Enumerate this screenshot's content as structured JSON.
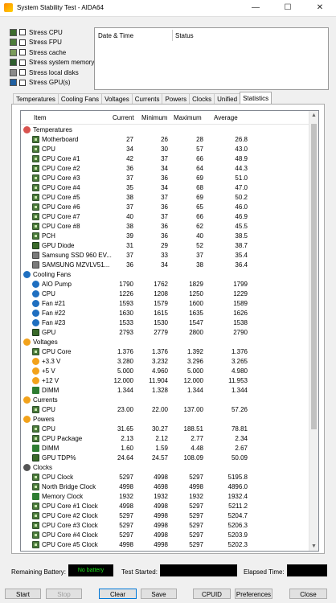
{
  "window": {
    "title": "System Stability Test - AIDA64",
    "minimize": "—",
    "maximize": "☐",
    "close": "✕"
  },
  "stress": [
    {
      "label": "Stress CPU",
      "checked": false
    },
    {
      "label": "Stress FPU",
      "checked": false
    },
    {
      "label": "Stress cache",
      "checked": false
    },
    {
      "label": "Stress system memory",
      "checked": false
    },
    {
      "label": "Stress local disks",
      "checked": false
    },
    {
      "label": "Stress GPU(s)",
      "checked": false
    }
  ],
  "log": {
    "col_date": "Date & Time",
    "col_status": "Status"
  },
  "tabs": [
    "Temperatures",
    "Cooling Fans",
    "Voltages",
    "Currents",
    "Powers",
    "Clocks",
    "Unified",
    "Statistics"
  ],
  "active_tab": "Statistics",
  "stats": {
    "headers": {
      "item": "Item",
      "current": "Current",
      "minimum": "Minimum",
      "maximum": "Maximum",
      "average": "Average"
    },
    "rows": [
      {
        "kind": "section",
        "icon": "temperature-icon",
        "label": "Temperatures"
      },
      {
        "kind": "item",
        "icon": "chip",
        "label": "Motherboard",
        "cur": "27",
        "min": "26",
        "max": "28",
        "avg": "26.8"
      },
      {
        "kind": "item",
        "icon": "chip",
        "label": "CPU",
        "cur": "34",
        "min": "30",
        "max": "57",
        "avg": "43.0"
      },
      {
        "kind": "item",
        "icon": "chip",
        "label": "CPU Core #1",
        "cur": "42",
        "min": "37",
        "max": "66",
        "avg": "48.9"
      },
      {
        "kind": "item",
        "icon": "chip",
        "label": "CPU Core #2",
        "cur": "36",
        "min": "34",
        "max": "64",
        "avg": "44.3"
      },
      {
        "kind": "item",
        "icon": "chip",
        "label": "CPU Core #3",
        "cur": "37",
        "min": "36",
        "max": "69",
        "avg": "51.0"
      },
      {
        "kind": "item",
        "icon": "chip",
        "label": "CPU Core #4",
        "cur": "35",
        "min": "34",
        "max": "68",
        "avg": "47.0"
      },
      {
        "kind": "item",
        "icon": "chip",
        "label": "CPU Core #5",
        "cur": "38",
        "min": "37",
        "max": "69",
        "avg": "50.2"
      },
      {
        "kind": "item",
        "icon": "chip",
        "label": "CPU Core #6",
        "cur": "37",
        "min": "36",
        "max": "65",
        "avg": "46.0"
      },
      {
        "kind": "item",
        "icon": "chip",
        "label": "CPU Core #7",
        "cur": "40",
        "min": "37",
        "max": "66",
        "avg": "46.9"
      },
      {
        "kind": "item",
        "icon": "chip",
        "label": "CPU Core #8",
        "cur": "38",
        "min": "36",
        "max": "62",
        "avg": "45.5"
      },
      {
        "kind": "item",
        "icon": "chip",
        "label": "PCH",
        "cur": "39",
        "min": "36",
        "max": "40",
        "avg": "38.5"
      },
      {
        "kind": "item",
        "icon": "gpu",
        "label": "GPU Diode",
        "cur": "31",
        "min": "29",
        "max": "52",
        "avg": "38.7"
      },
      {
        "kind": "item",
        "icon": "disk",
        "label": "Samsung SSD 960 EV...",
        "cur": "37",
        "min": "33",
        "max": "37",
        "avg": "35.4"
      },
      {
        "kind": "item",
        "icon": "disk",
        "label": "SAMSUNG MZVLV51...",
        "cur": "36",
        "min": "34",
        "max": "38",
        "avg": "36.4"
      },
      {
        "kind": "section",
        "icon": "fan-icon",
        "label": "Cooling Fans"
      },
      {
        "kind": "item",
        "icon": "fan",
        "label": "AIO Pump",
        "cur": "1790",
        "min": "1762",
        "max": "1829",
        "avg": "1799"
      },
      {
        "kind": "item",
        "icon": "fan",
        "label": "CPU",
        "cur": "1226",
        "min": "1208",
        "max": "1250",
        "avg": "1229"
      },
      {
        "kind": "item",
        "icon": "fan",
        "label": "Fan #21",
        "cur": "1593",
        "min": "1579",
        "max": "1600",
        "avg": "1589"
      },
      {
        "kind": "item",
        "icon": "fan",
        "label": "Fan #22",
        "cur": "1630",
        "min": "1615",
        "max": "1635",
        "avg": "1626"
      },
      {
        "kind": "item",
        "icon": "fan",
        "label": "Fan #23",
        "cur": "1533",
        "min": "1530",
        "max": "1547",
        "avg": "1538"
      },
      {
        "kind": "item",
        "icon": "gpu",
        "label": "GPU",
        "cur": "2793",
        "min": "2779",
        "max": "2800",
        "avg": "2790"
      },
      {
        "kind": "section",
        "icon": "voltage-icon",
        "label": "Voltages"
      },
      {
        "kind": "item",
        "icon": "chip",
        "label": "CPU Core",
        "cur": "1.376",
        "min": "1.376",
        "max": "1.392",
        "avg": "1.376"
      },
      {
        "kind": "item",
        "icon": "volt",
        "label": "+3.3 V",
        "cur": "3.280",
        "min": "3.232",
        "max": "3.296",
        "avg": "3.265"
      },
      {
        "kind": "item",
        "icon": "volt",
        "label": "+5 V",
        "cur": "5.000",
        "min": "4.960",
        "max": "5.000",
        "avg": "4.980"
      },
      {
        "kind": "item",
        "icon": "volt",
        "label": "+12 V",
        "cur": "12.000",
        "min": "11.904",
        "max": "12.000",
        "avg": "11.953"
      },
      {
        "kind": "item",
        "icon": "mem",
        "label": "DIMM",
        "cur": "1.344",
        "min": "1.328",
        "max": "1.344",
        "avg": "1.344"
      },
      {
        "kind": "section",
        "icon": "current-icon",
        "label": "Currents"
      },
      {
        "kind": "item",
        "icon": "chip",
        "label": "CPU",
        "cur": "23.00",
        "min": "22.00",
        "max": "137.00",
        "avg": "57.26"
      },
      {
        "kind": "section",
        "icon": "power-icon",
        "label": "Powers"
      },
      {
        "kind": "item",
        "icon": "chip",
        "label": "CPU",
        "cur": "31.65",
        "min": "30.27",
        "max": "188.51",
        "avg": "78.81"
      },
      {
        "kind": "item",
        "icon": "chip",
        "label": "CPU Package",
        "cur": "2.13",
        "min": "2.12",
        "max": "2.77",
        "avg": "2.34"
      },
      {
        "kind": "item",
        "icon": "mem",
        "label": "DIMM",
        "cur": "1.60",
        "min": "1.59",
        "max": "4.48",
        "avg": "2.67"
      },
      {
        "kind": "item",
        "icon": "gpu",
        "label": "GPU TDP%",
        "cur": "24.64",
        "min": "24.57",
        "max": "108.09",
        "avg": "50.09"
      },
      {
        "kind": "section",
        "icon": "clock-icon",
        "label": "Clocks"
      },
      {
        "kind": "item",
        "icon": "chip",
        "label": "CPU Clock",
        "cur": "5297",
        "min": "4998",
        "max": "5297",
        "avg": "5195.8"
      },
      {
        "kind": "item",
        "icon": "chip",
        "label": "North Bridge Clock",
        "cur": "4998",
        "min": "4698",
        "max": "4998",
        "avg": "4896.0"
      },
      {
        "kind": "item",
        "icon": "mem",
        "label": "Memory Clock",
        "cur": "1932",
        "min": "1932",
        "max": "1932",
        "avg": "1932.4"
      },
      {
        "kind": "item",
        "icon": "chip",
        "label": "CPU Core #1 Clock",
        "cur": "4998",
        "min": "4998",
        "max": "5297",
        "avg": "5211.2"
      },
      {
        "kind": "item",
        "icon": "chip",
        "label": "CPU Core #2 Clock",
        "cur": "5297",
        "min": "4998",
        "max": "5297",
        "avg": "5204.7"
      },
      {
        "kind": "item",
        "icon": "chip",
        "label": "CPU Core #3 Clock",
        "cur": "5297",
        "min": "4998",
        "max": "5297",
        "avg": "5206.3"
      },
      {
        "kind": "item",
        "icon": "chip",
        "label": "CPU Core #4 Clock",
        "cur": "5297",
        "min": "4998",
        "max": "5297",
        "avg": "5203.9"
      },
      {
        "kind": "item",
        "icon": "chip",
        "label": "CPU Core #5 Clock",
        "cur": "4998",
        "min": "4998",
        "max": "5297",
        "avg": "5202.3"
      }
    ]
  },
  "status": {
    "battery_label": "Remaining Battery:",
    "battery_value": "No battery",
    "started_label": "Test Started:",
    "elapsed_label": "Elapsed Time:"
  },
  "buttons": {
    "start": "Start",
    "stop": "Stop",
    "clear": "Clear",
    "save": "Save",
    "cpuid": "CPUID",
    "preferences": "Preferences",
    "close": "Close"
  },
  "colors": {
    "battery_text": "#18e018",
    "accent": "#0078d7"
  }
}
